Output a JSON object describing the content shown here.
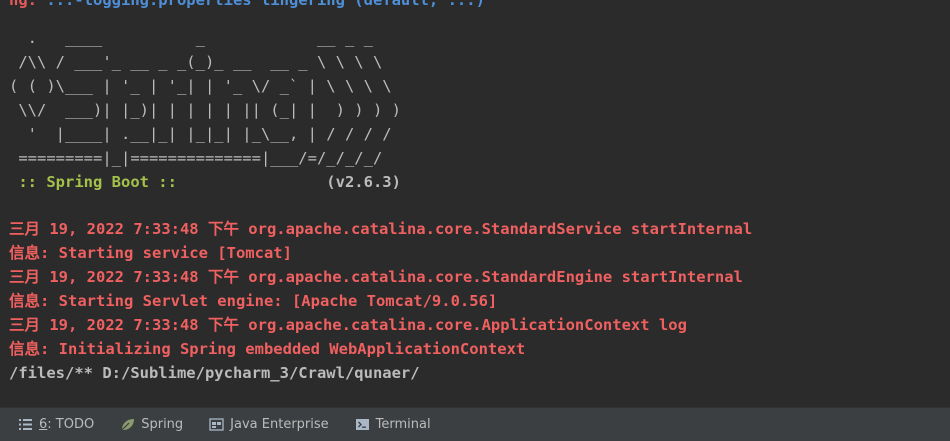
{
  "console": {
    "cut_line_prefix": "ng: ",
    "cut_line_link": "...-logging.properties lingering (default, ...)",
    "banner": [
      "  .   ____          _            __ _ _",
      " /\\\\ / ___'_ __ _ _(_)_ __  __ _ \\ \\ \\ \\",
      "( ( )\\___ | '_ | '_| | '_ \\/ _` | \\ \\ \\ \\",
      " \\\\/  ___)| |_)| | | | | || (_| |  ) ) ) )",
      "  '  |____| .__|_| |_|_| |_\\__, | / / / /",
      " =========|_|==============|___/=/_/_/_/"
    ],
    "spring_boot_label": " :: Spring Boot :: ",
    "spring_boot_version": "               (v2.6.3)",
    "log_lines": [
      {
        "text": "三月 19, 2022 7:33:48 下午 org.apache.catalina.core.StandardService startInternal",
        "kind": "red"
      },
      {
        "text": "信息: Starting service [Tomcat]",
        "kind": "red"
      },
      {
        "text": "三月 19, 2022 7:33:48 下午 org.apache.catalina.core.StandardEngine startInternal",
        "kind": "red"
      },
      {
        "text": "信息: Starting Servlet engine: [Apache Tomcat/9.0.56]",
        "kind": "red"
      },
      {
        "text": "三月 19, 2022 7:33:48 下午 org.apache.catalina.core.ApplicationContext log",
        "kind": "red"
      },
      {
        "text": "信息: Initializing Spring embedded WebApplicationContext",
        "kind": "red"
      },
      {
        "text": "/files/** D:/Sublime/pycharm_3/Crawl/qunaer/",
        "kind": "plain"
      }
    ]
  },
  "toolbar": {
    "todo_num": "6",
    "todo_label": ": TODO",
    "spring_label": "Spring",
    "java_label": "Java Enterprise",
    "terminal_label": "Terminal"
  },
  "colors": {
    "background": "#2b2b2b",
    "error_red": "#f06060",
    "spring_green": "#a4c14b",
    "toolbar_bg": "#3c3f41"
  },
  "icons": [
    "todo-list-icon",
    "spring-leaf-icon",
    "java-enterprise-icon",
    "terminal-icon"
  ]
}
